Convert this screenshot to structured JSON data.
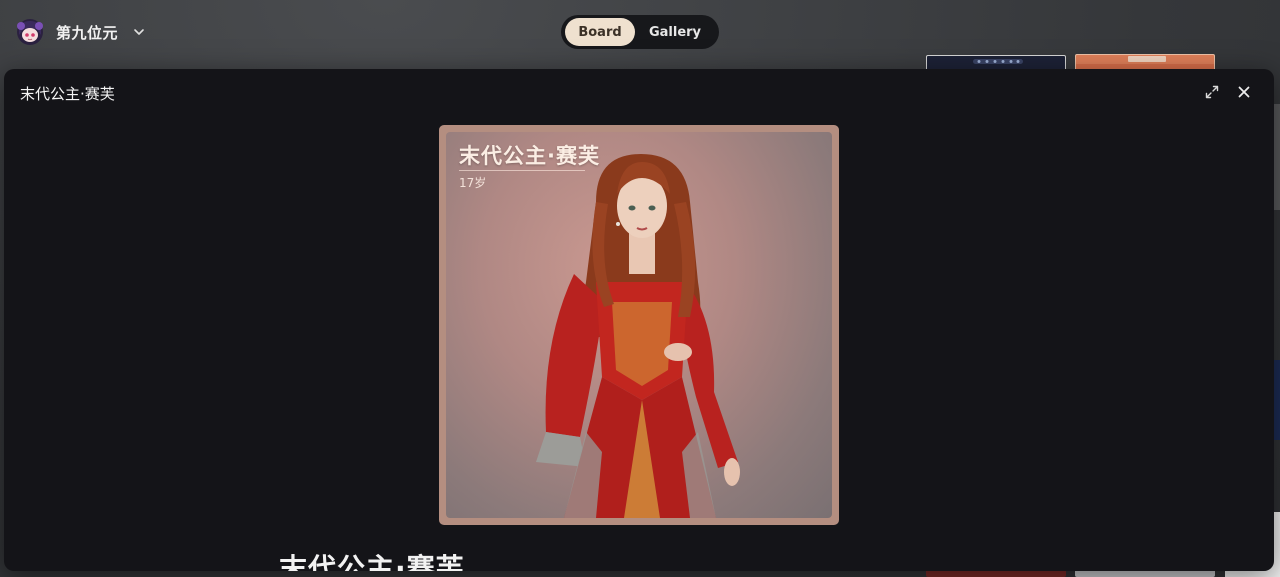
{
  "workspace": {
    "name": "第九位元",
    "avatar_icon": "chibi-avatar-icon"
  },
  "tabs": [
    {
      "label": "Board",
      "active": true
    },
    {
      "label": "Gallery",
      "active": false
    }
  ],
  "modal": {
    "title": "末代公主·赛芙",
    "expand_icon": "expand-icon",
    "close_icon": "close-icon",
    "card": {
      "name": "末代公主·赛芙",
      "age": "17岁"
    },
    "heading": "末代公主·赛芙"
  },
  "colors": {
    "tab_active_bg": "#efe1cf",
    "modal_bg": "#141418",
    "card_frame": "#b48e80",
    "dress_red": "#b8221f",
    "hair_auburn": "#8a3a1c"
  }
}
